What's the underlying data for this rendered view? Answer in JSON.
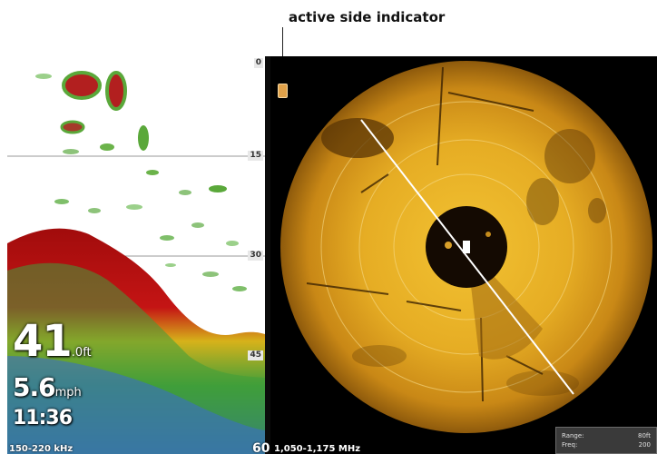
{
  "callout": {
    "text": "active side indicator"
  },
  "left_pane": {
    "depth_ticks": [
      "0",
      "15",
      "30",
      "45"
    ],
    "depth_value": "41",
    "depth_unit": ".0ft",
    "speed_value": "5.6",
    "speed_unit": "mph",
    "time": "11:36",
    "frequency": "150-220 kHz",
    "bottom_depth": "60"
  },
  "right_pane": {
    "frequency": "1,050-1,175 MHz",
    "info": {
      "range_label": "Range:",
      "range_value": "80ft",
      "freq_label": "Freq:",
      "freq_value": "200"
    }
  },
  "colors": {
    "sonar_gold": "#e1a420",
    "sonar_dark": "#7a4a08",
    "bottom_red": "#b20f0f",
    "fish_green": "#5aa83a",
    "background": "#000000"
  }
}
